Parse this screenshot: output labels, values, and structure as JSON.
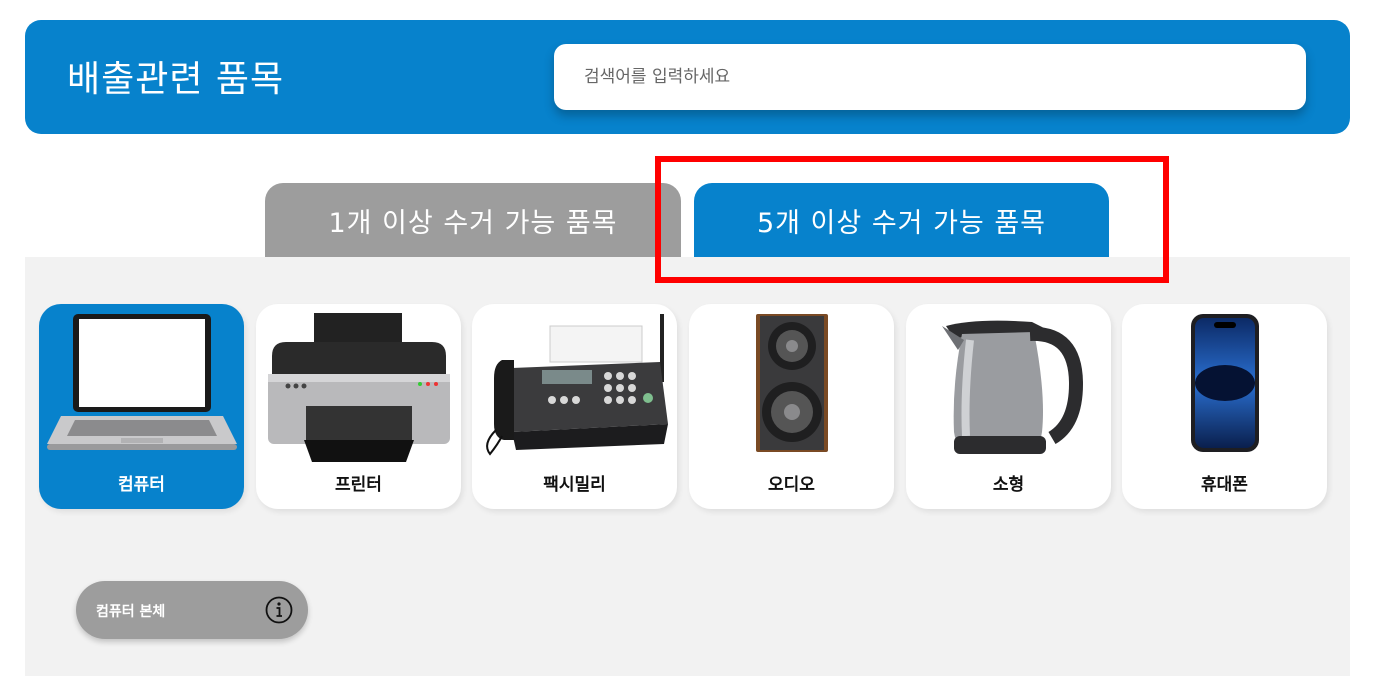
{
  "header": {
    "title": "배출관련 품목"
  },
  "search": {
    "placeholder": "검색어를 입력하세요"
  },
  "tabs": [
    {
      "label": "1개 이상 수거 가능 품목",
      "active": false
    },
    {
      "label": "5개 이상 수거 가능 품목",
      "active": true
    }
  ],
  "categories": [
    {
      "label": "컴퓨터",
      "icon": "laptop-icon",
      "active": true
    },
    {
      "label": "프린터",
      "icon": "printer-icon",
      "active": false
    },
    {
      "label": "팩시밀리",
      "icon": "fax-icon",
      "active": false
    },
    {
      "label": "오디오",
      "icon": "speaker-icon",
      "active": false
    },
    {
      "label": "소형",
      "icon": "kettle-icon",
      "active": false
    },
    {
      "label": "휴대폰",
      "icon": "smartphone-icon",
      "active": false
    }
  ],
  "subitem": {
    "label": "컴퓨터 본체",
    "icon": "info-icon"
  },
  "colors": {
    "accent": "#0782cc",
    "inactive": "#9d9d9d",
    "highlight": "#ff0000",
    "panel": "#f2f2f2"
  }
}
